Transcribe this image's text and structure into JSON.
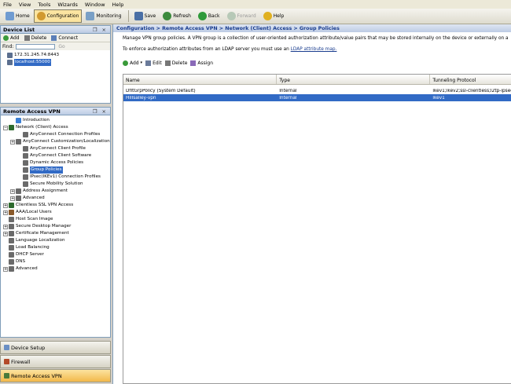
{
  "menu": [
    "File",
    "View",
    "Tools",
    "Wizards",
    "Window",
    "Help"
  ],
  "toolbar": {
    "home": "Home",
    "configuration": "Configuration",
    "monitoring": "Monitoring",
    "save": "Save",
    "refresh": "Refresh",
    "back": "Back",
    "forward": "Forward",
    "help": "Help"
  },
  "device_list": {
    "title": "Device List",
    "controls": "❐ ×",
    "add": "Add",
    "delete": "Delete",
    "connect": "Connect",
    "find_label": "Find:",
    "go": "Go",
    "devices": [
      "172.31.245.74:8443",
      "localhost:55000"
    ]
  },
  "ravpn": {
    "title": "Remote Access VPN",
    "controls": "❐ ×",
    "tree": [
      {
        "label": "Introduction",
        "indent": 1,
        "exp": "",
        "color": "#3b7fd4"
      },
      {
        "label": "Network (Client) Access",
        "indent": 0,
        "exp": "−",
        "color": "#2d6a2d"
      },
      {
        "label": "AnyConnect Connection Profiles",
        "indent": 2,
        "exp": "",
        "color": "#6a6a6a"
      },
      {
        "label": "AnyConnect Customization/Localization",
        "indent": 1,
        "exp": "+",
        "color": "#6a6a6a"
      },
      {
        "label": "AnyConnect Client Profile",
        "indent": 2,
        "exp": "",
        "color": "#6a6a6a"
      },
      {
        "label": "AnyConnect Client Software",
        "indent": 2,
        "exp": "",
        "color": "#6a6a6a"
      },
      {
        "label": "Dynamic Access Policies",
        "indent": 2,
        "exp": "",
        "color": "#6a6a6a"
      },
      {
        "label": "Group Policies",
        "indent": 2,
        "exp": "",
        "color": "#6a6a6a",
        "selected": true
      },
      {
        "label": "IPsec(IKEv1) Connection Profiles",
        "indent": 2,
        "exp": "",
        "color": "#6a6a6a"
      },
      {
        "label": "Secure Mobility Solution",
        "indent": 2,
        "exp": "",
        "color": "#6a6a6a"
      },
      {
        "label": "Address Assignment",
        "indent": 1,
        "exp": "+",
        "color": "#6a6a6a"
      },
      {
        "label": "Advanced",
        "indent": 1,
        "exp": "+",
        "color": "#6a6a6a"
      },
      {
        "label": "Clientless SSL VPN Access",
        "indent": 0,
        "exp": "+",
        "color": "#2d6a2d"
      },
      {
        "label": "AAA/Local Users",
        "indent": 0,
        "exp": "+",
        "color": "#8a5a2a"
      },
      {
        "label": "Host Scan Image",
        "indent": 0,
        "exp": "",
        "color": "#6a6a6a"
      },
      {
        "label": "Secure Desktop Manager",
        "indent": 0,
        "exp": "+",
        "color": "#6a6a6a"
      },
      {
        "label": "Certificate Management",
        "indent": 0,
        "exp": "+",
        "color": "#6a6a6a"
      },
      {
        "label": "Language Localization",
        "indent": 0,
        "exp": "",
        "color": "#6a6a6a"
      },
      {
        "label": "Load Balancing",
        "indent": 0,
        "exp": "",
        "color": "#6a6a6a"
      },
      {
        "label": "DHCP Server",
        "indent": 0,
        "exp": "",
        "color": "#6a6a6a"
      },
      {
        "label": "DNS",
        "indent": 0,
        "exp": "",
        "color": "#6a6a6a"
      },
      {
        "label": "Advanced",
        "indent": 0,
        "exp": "+",
        "color": "#6a6a6a"
      }
    ]
  },
  "nav": [
    "Device Setup",
    "Firewall",
    "Remote Access VPN"
  ],
  "main": {
    "breadcrumb": "Configuration > Remote Access VPN > Network (Client) Access > Group Policies",
    "description": "Manage VPN group policies. A VPN group is a collection of user-oriented authorization attribute/value pairs that may be stored internally on the device or externally on a RADIUS/LDAP server.",
    "ldap_text": "To enforce authorization attributes from an LDAP server you must use an",
    "ldap_link": "LDAP attribute map.",
    "actions": {
      "add": "Add",
      "edit": "Edit",
      "delete": "Delete",
      "assign": "Assign"
    },
    "columns": [
      "Name",
      "Type",
      "Tunneling Protocol"
    ],
    "rows": [
      [
        "DfltGrpPolicy (System Default)",
        "Internal",
        "ikev1;ikev2;ssl-clientless;l2tp-ipsec"
      ],
      [
        "Hillsalley-vpn",
        "Internal",
        "ikev1"
      ]
    ]
  }
}
